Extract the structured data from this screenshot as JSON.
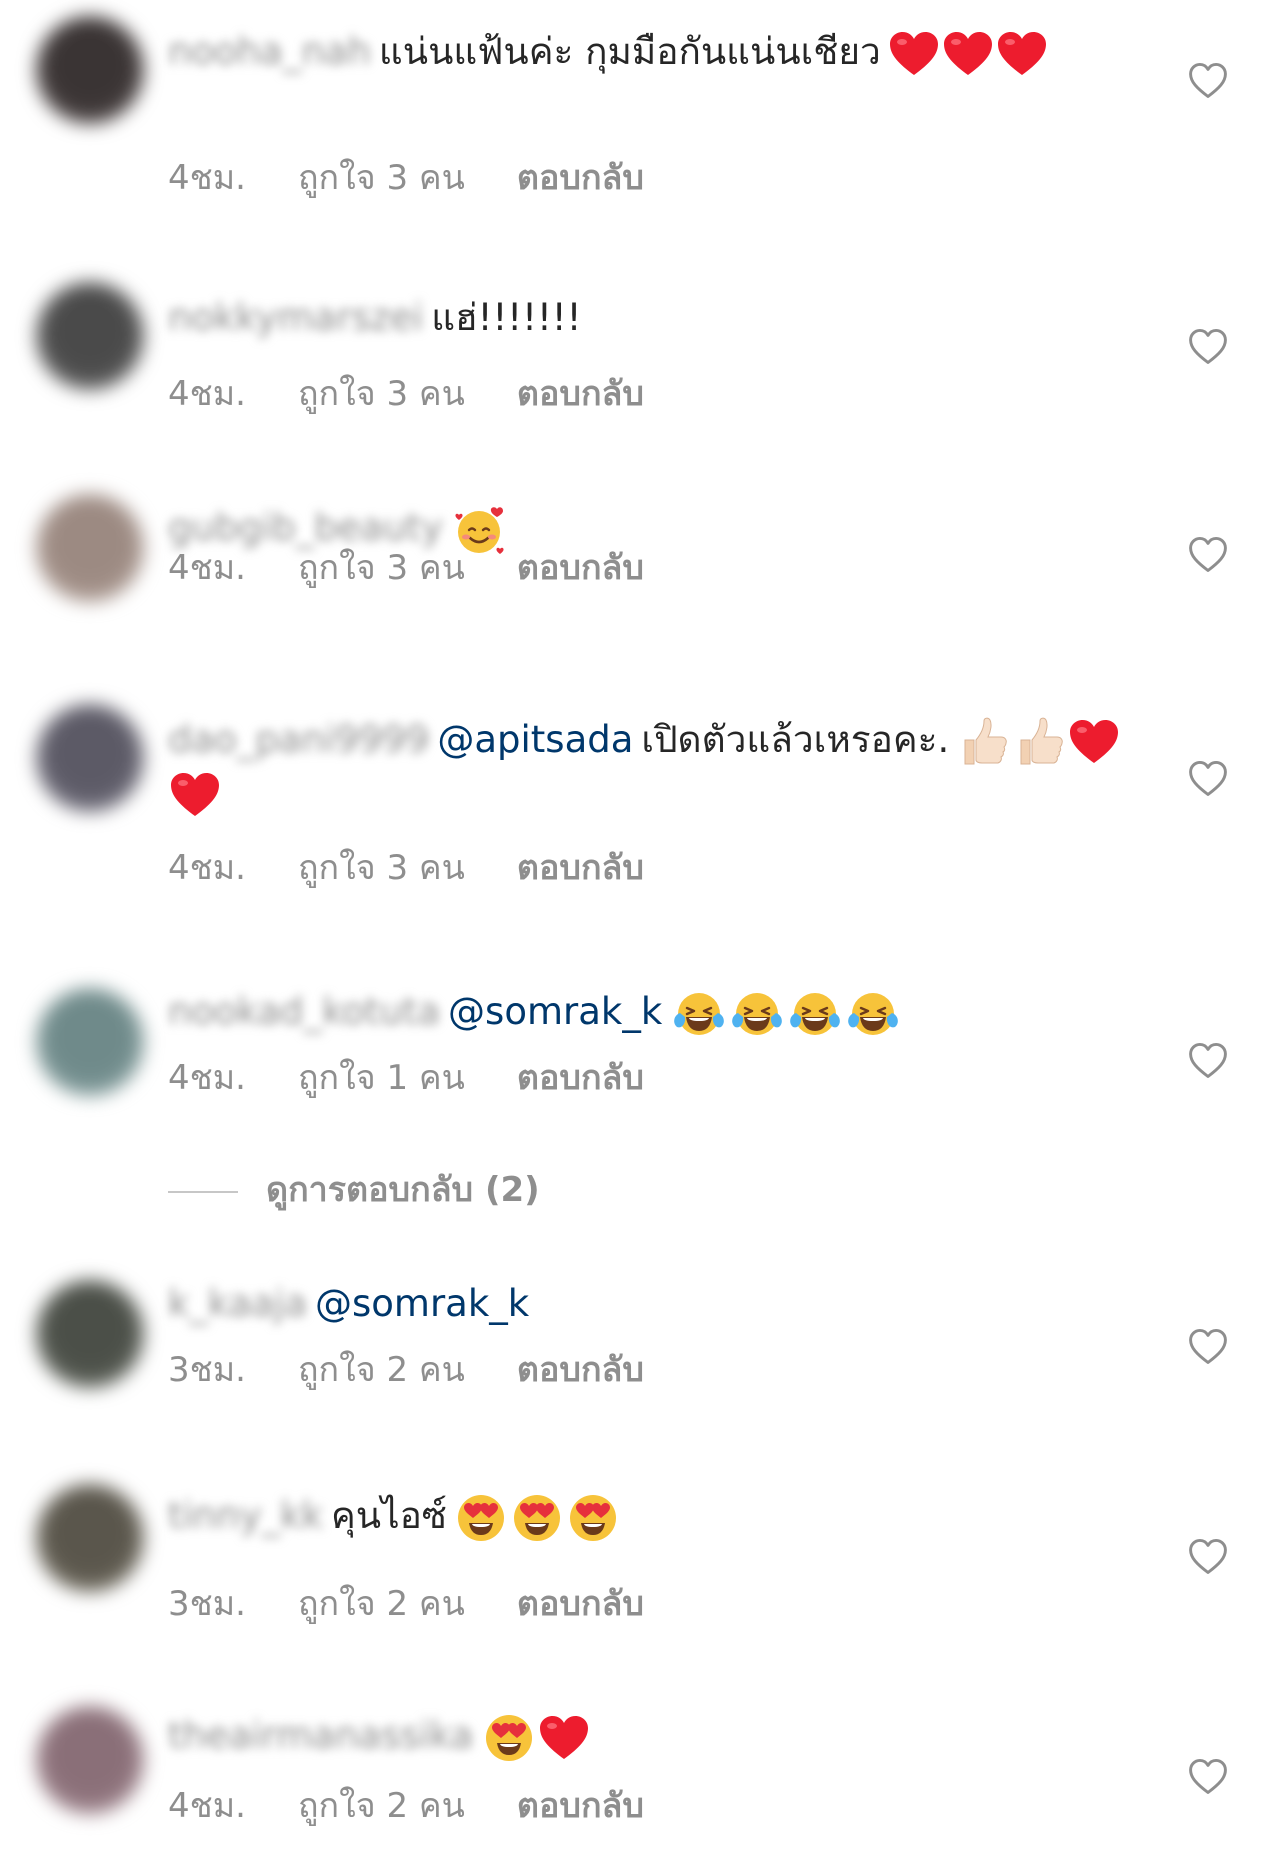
{
  "comments": [
    {
      "username": "nooha_nah",
      "mention": "",
      "text": "แน่นแฟ้นค่ะ กุมมือกันแน่นเชียว",
      "emojis": [
        "heart",
        "heart",
        "heart"
      ],
      "time": "4ชม.",
      "likes": "ถูกใจ 3 คน",
      "reply": "ตอบกลับ",
      "avatar_color": "#3a3434"
    },
    {
      "username": "nokkymarszei",
      "mention": "",
      "text": "แฮ่!!!!!!!",
      "emojis": [],
      "time": "4ชม.",
      "likes": "ถูกใจ 3 คน",
      "reply": "ตอบกลับ",
      "avatar_color": "#4a4a4a"
    },
    {
      "username": "gubgib_beauty",
      "mention": "",
      "text": "",
      "emojis": [
        "smiling-hearts"
      ],
      "time": "4ชม.",
      "likes": "ถูกใจ 3 คน",
      "reply": "ตอบกลับ",
      "avatar_color": "#9c8a82"
    },
    {
      "username": "dao_pani9999",
      "mention": "@apitsada",
      "text": "เปิดตัวแล้วเหรอคะ.",
      "emojis": [
        "thumbs-up",
        "thumbs-up",
        "heart",
        "heart"
      ],
      "time": "4ชม.",
      "likes": "ถูกใจ 3 คน",
      "reply": "ตอบกลับ",
      "avatar_color": "#5c5a66"
    },
    {
      "username": "nookad_kotuta",
      "mention": "@somrak_k",
      "text": "",
      "emojis": [
        "tears-of-joy",
        "tears-of-joy",
        "tears-of-joy",
        "tears-of-joy"
      ],
      "time": "4ชม.",
      "likes": "ถูกใจ 1 คน",
      "reply": "ตอบกลับ",
      "avatar_color": "#6f8a8a"
    },
    {
      "username": "k_kaaja",
      "mention": "@somrak_k",
      "text": "",
      "emojis": [],
      "time": "3ชม.",
      "likes": "ถูกใจ 2 คน",
      "reply": "ตอบกลับ",
      "avatar_color": "#4b4f48"
    },
    {
      "username": "tinny_kk",
      "mention": "",
      "text": "คุนไอซ์",
      "emojis": [
        "heart-eyes",
        "heart-eyes",
        "heart-eyes"
      ],
      "time": "3ชม.",
      "likes": "ถูกใจ 2 คน",
      "reply": "ตอบกลับ",
      "avatar_color": "#5a564c"
    },
    {
      "username": "theairmanassika",
      "mention": "",
      "text": "",
      "emojis": [
        "heart-eyes",
        "heart"
      ],
      "time": "4ชม.",
      "likes": "ถูกใจ 2 คน",
      "reply": "ตอบกลับ",
      "avatar_color": "#8a6f78"
    }
  ],
  "view_replies": "ดูการตอบกลับ (2)",
  "like_icon": "heart-outline-icon",
  "colors": {
    "text": "#262626",
    "muted": "#8e8e8e",
    "mention": "#00376b",
    "heart": "#ed1c2e"
  }
}
